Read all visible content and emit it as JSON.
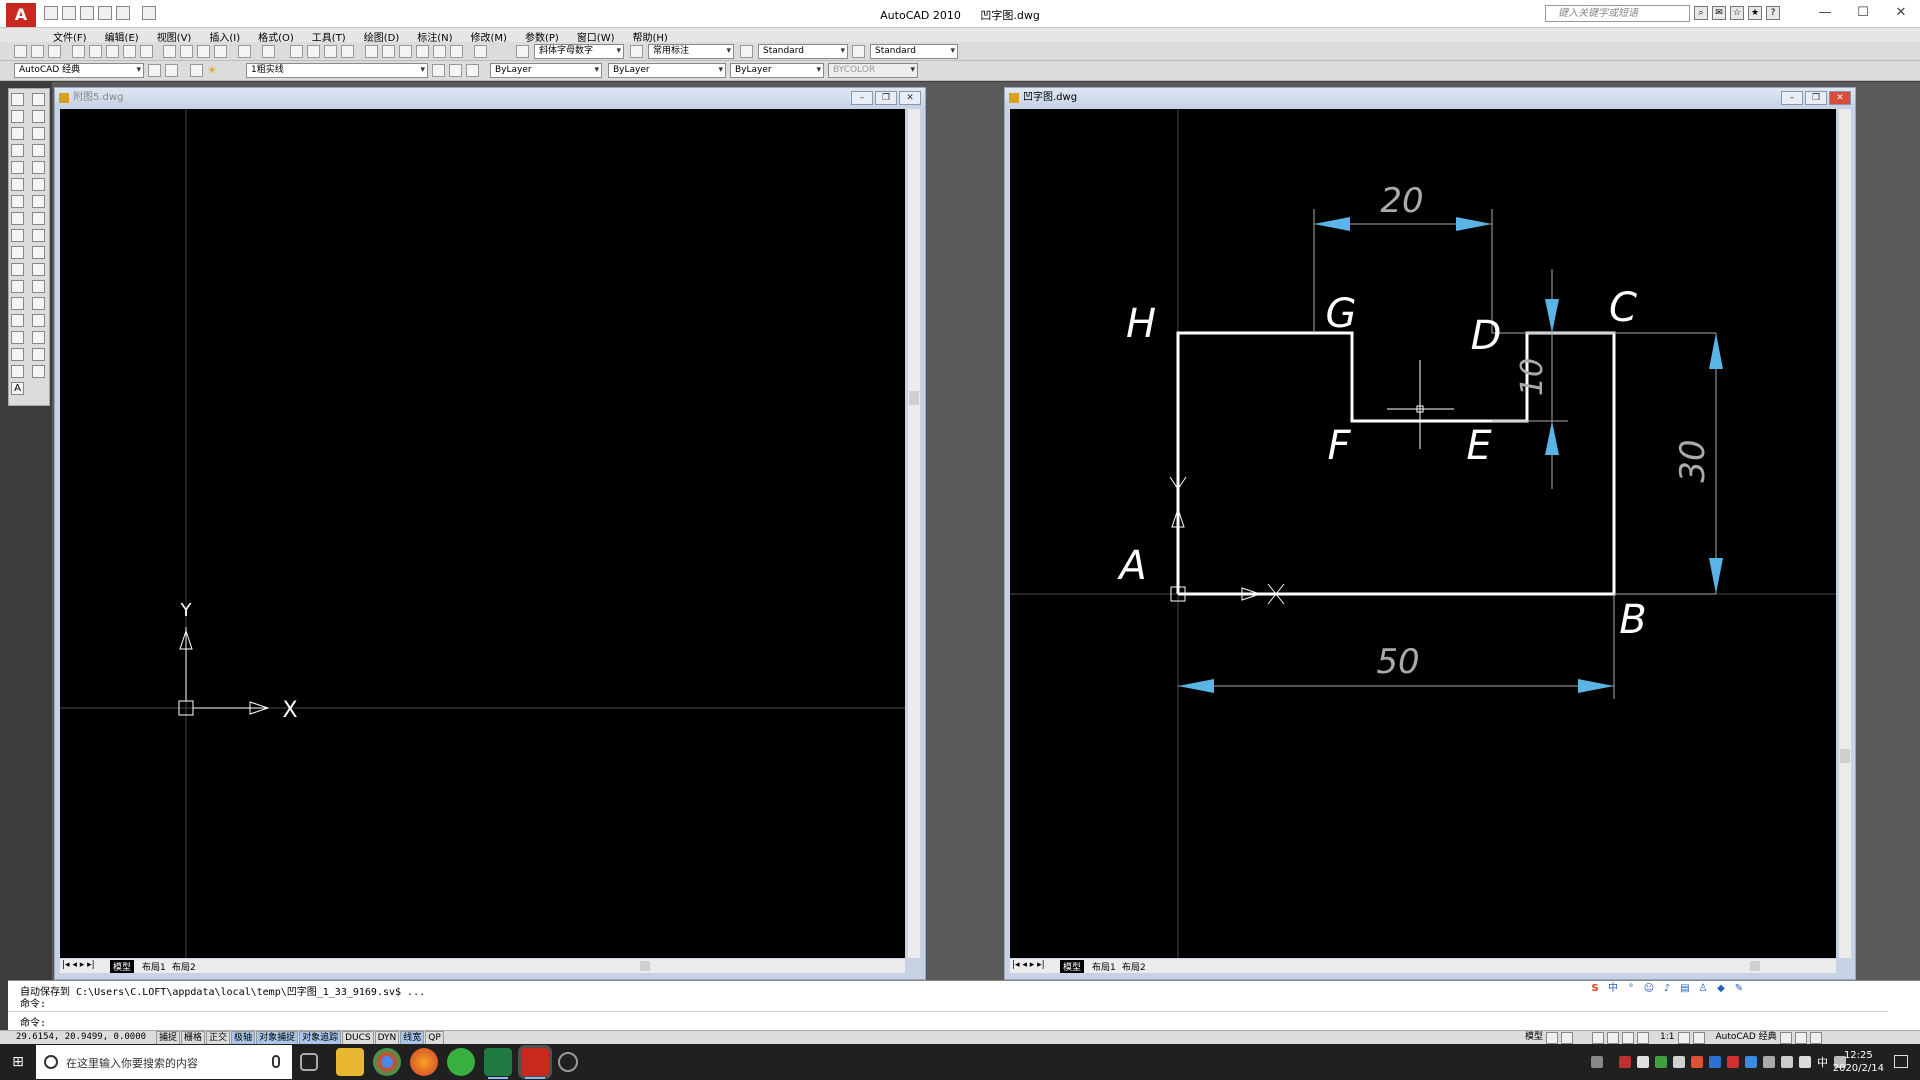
{
  "app": {
    "title": "AutoCAD 2010",
    "active_file": "凹字图.dwg",
    "search_placeholder": "键入关键字或短语",
    "logo_letter": "A"
  },
  "menu": [
    "文件(F)",
    "编辑(E)",
    "视图(V)",
    "插入(I)",
    "格式(O)",
    "工具(T)",
    "绘图(D)",
    "标注(N)",
    "修改(M)",
    "参数(P)",
    "窗口(W)",
    "帮助(H)"
  ],
  "toolbar1": {
    "text_style": "斜体字母数字",
    "dim_style": "常用标注",
    "table_style": "Standard",
    "multileader_style": "Standard"
  },
  "toolbar2": {
    "workspace": "AutoCAD 经典",
    "layer": "1粗实线",
    "color": "ByLayer",
    "linetype": "ByLayer",
    "lineweight": "ByLayer",
    "plotstyle": "BYCOLOR"
  },
  "left_window": {
    "title": "附图5.dwg",
    "tabs": [
      "模型",
      "布局1",
      "布局2"
    ],
    "ucs": {
      "x": "X",
      "y": "Y"
    }
  },
  "right_window": {
    "title": "凹字图.dwg",
    "tabs": [
      "模型",
      "布局1",
      "布局2"
    ],
    "ucs": {
      "x": "X",
      "y": "Y"
    }
  },
  "drawing": {
    "points": {
      "A": "A",
      "B": "B",
      "C": "C",
      "D": "D",
      "E": "E",
      "F": "F",
      "G": "G",
      "H": "H"
    },
    "dimensions": {
      "top": "20",
      "notch_depth": "10",
      "height": "30",
      "bottom": "50"
    },
    "line_color": "#ffffff",
    "dim_color": "#5ab4e6"
  },
  "command": {
    "autosave": "自动保存到 C:\\Users\\C.LOFT\\appdata\\local\\temp\\凹字图_1_33_9169.sv$ ...",
    "line2": "命令:",
    "prompt": "命令:"
  },
  "status": {
    "coords": "29.6154,  20.9499,  0.0000",
    "toggles": [
      {
        "label": "捕捉",
        "on": false
      },
      {
        "label": "栅格",
        "on": false
      },
      {
        "label": "正交",
        "on": false
      },
      {
        "label": "极轴",
        "on": true
      },
      {
        "label": "对象捕捉",
        "on": true
      },
      {
        "label": "对象追踪",
        "on": true
      },
      {
        "label": "DUCS",
        "on": false
      },
      {
        "label": "DYN",
        "on": false
      },
      {
        "label": "线宽",
        "on": true
      },
      {
        "label": "QP",
        "on": false
      }
    ],
    "model": "模型",
    "scale": "1:1",
    "workspace": "AutoCAD 经典"
  },
  "taskbar": {
    "search_text": "在这里输入你要搜索的内容",
    "time": "12:25",
    "date": "2020/2/14",
    "ime_lang": "中"
  },
  "ime": {
    "label": "中"
  }
}
